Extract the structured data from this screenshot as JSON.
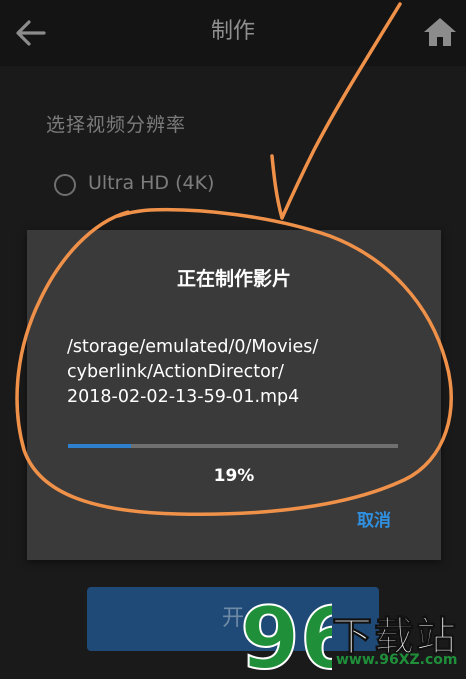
{
  "header": {
    "title": "制作"
  },
  "resolution": {
    "label": "选择视频分辨率",
    "option": "Ultra HD (4K)"
  },
  "start_button": {
    "label": "开"
  },
  "dialog": {
    "title": "正在制作影片",
    "path_lines": [
      "/storage/emulated/0/Movies/",
      "cyberlink/ActionDirector/",
      "2018-02-02-13-59-01.mp4"
    ],
    "progress": 0.19,
    "progress_text": "19%",
    "cancel_label": "取消"
  },
  "watermark": {
    "text": "下载站",
    "url": "www.96XZ.com",
    "logo": "96"
  },
  "colors": {
    "accent": "#2f90e0",
    "progress_fill": "#2f7fcf",
    "annotation": "#f0914a",
    "watermark_logo": "#1f8f3a"
  },
  "icons": [
    "back-arrow-icon",
    "home-icon",
    "radio-button-icon"
  ]
}
